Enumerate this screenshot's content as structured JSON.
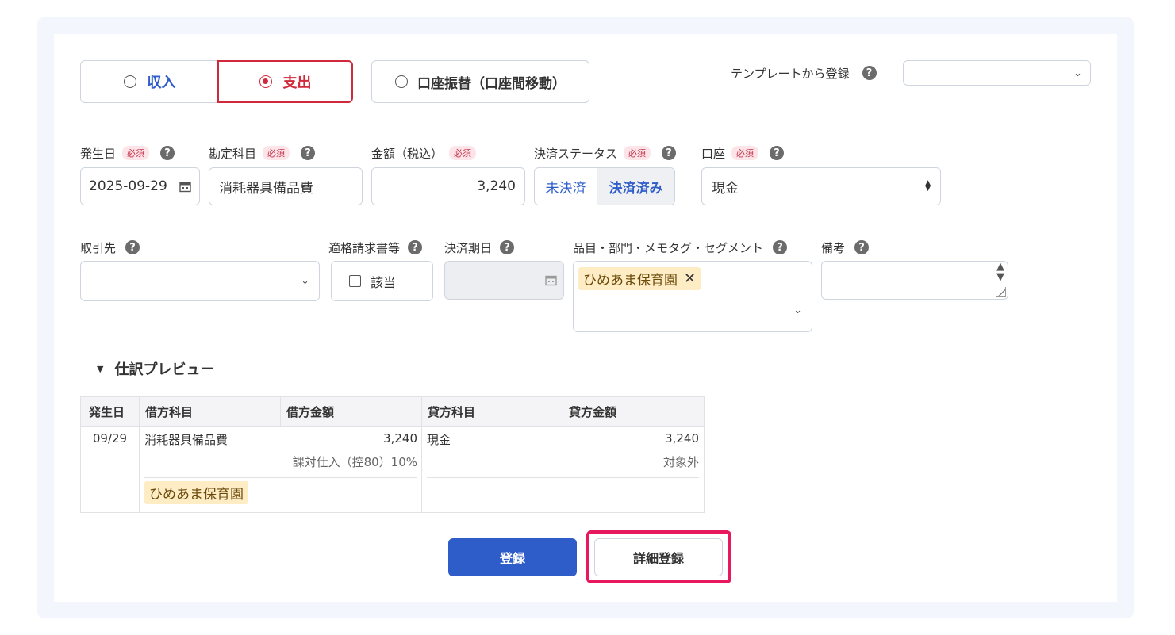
{
  "type_tabs": {
    "income": "収入",
    "expense": "支出",
    "transfer": "口座振替（口座間移動）"
  },
  "template": {
    "label": "テンプレートから登録",
    "value": ""
  },
  "required_badge": "必須",
  "fields": {
    "date": {
      "label": "発生日",
      "value": "2025-09-29"
    },
    "account_title": {
      "label": "勘定科目",
      "value": "消耗器具備品費"
    },
    "amount": {
      "label": "金額（税込）",
      "value": "3,240"
    },
    "settlement_status": {
      "label": "決済ステータス",
      "unsettled": "未決済",
      "settled": "決済済み"
    },
    "wallet": {
      "label": "口座",
      "value": "現金"
    },
    "partner": {
      "label": "取引先",
      "value": ""
    },
    "qualified_invoice": {
      "label": "適格請求書等",
      "checkbox_label": "該当"
    },
    "due_date": {
      "label": "決済期日",
      "value": ""
    },
    "tags": {
      "label": "品目・部門・メモタグ・セグメント",
      "selected": [
        "ひめあま保育園"
      ]
    },
    "memo": {
      "label": "備考",
      "value": ""
    }
  },
  "preview": {
    "title": "仕訳プレビュー",
    "headers": [
      "発生日",
      "借方科目",
      "借方金額",
      "貸方科目",
      "貸方金額"
    ],
    "row": {
      "date": "09/29",
      "debit_account": "消耗器具備品費",
      "debit_amount": "3,240",
      "debit_tax": "課対仕入（控80）10%",
      "debit_tag": "ひめあま保育園",
      "credit_account": "現金",
      "credit_amount": "3,240",
      "credit_tax": "対象外"
    }
  },
  "buttons": {
    "register": "登録",
    "detail_register": "詳細登録"
  },
  "colors": {
    "accent_red": "#d0293b",
    "primary_blue": "#2e5cc9",
    "highlight_pink": "#e8185f",
    "link_blue": "#2e5cc9"
  },
  "icons": [
    "help-icon",
    "calendar-icon",
    "chevron-down-icon",
    "caret-down-icon",
    "close-icon",
    "spinner-arrows-icon",
    "resize-handle-icon"
  ]
}
